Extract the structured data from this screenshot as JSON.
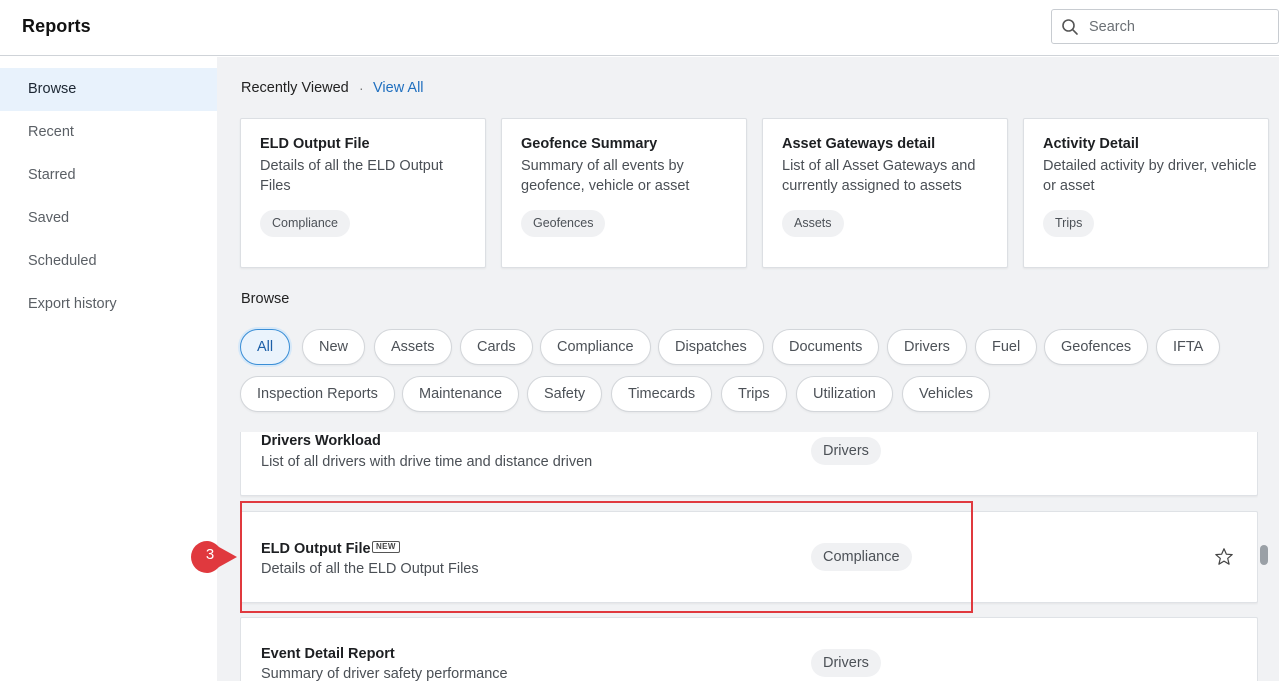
{
  "app": {
    "title": "Reports"
  },
  "search": {
    "placeholder": "Search"
  },
  "sidebar": {
    "items": [
      {
        "label": "Browse",
        "active": true
      },
      {
        "label": "Recent"
      },
      {
        "label": "Starred"
      },
      {
        "label": "Saved"
      },
      {
        "label": "Scheduled"
      },
      {
        "label": "Export history"
      }
    ]
  },
  "recently_viewed": {
    "title": "Recently Viewed",
    "separator": "·",
    "view_all": "View All",
    "cards": [
      {
        "title": "ELD Output File",
        "desc": "Details of all the ELD Output Files",
        "tag": "Compliance"
      },
      {
        "title": "Geofence Summary",
        "desc": "Summary of all events by geofence, vehicle or asset",
        "tag": "Geofences"
      },
      {
        "title": "Asset Gateways detail",
        "desc": "List of all Asset Gateways and currently assigned to assets",
        "tag": "Assets"
      },
      {
        "title": "Activity Detail",
        "desc": "Detailed activity by driver, vehicle or asset",
        "tag": "Trips"
      }
    ]
  },
  "browse": {
    "title": "Browse",
    "filters": [
      "All",
      "New",
      "Assets",
      "Cards",
      "Compliance",
      "Dispatches",
      "Documents",
      "Drivers",
      "Fuel",
      "Geofences",
      "IFTA",
      "Inspection Reports",
      "Maintenance",
      "Safety",
      "Timecards",
      "Trips",
      "Utilization",
      "Vehicles"
    ],
    "active_filter": "All",
    "reports": [
      {
        "title": "Drivers Workload",
        "desc": "List of all drivers with drive time and distance driven",
        "tag": "Drivers"
      },
      {
        "title": "ELD Output File",
        "badge": "NEW",
        "desc": "Details of all the ELD Output Files",
        "tag": "Compliance"
      },
      {
        "title": "Event Detail Report",
        "desc": "Summary of driver safety performance",
        "tag": "Drivers"
      }
    ]
  },
  "annotation": {
    "step": "3",
    "color": "#e0393e"
  },
  "colors": {
    "accent": "#1f6fbf",
    "active_bg": "#e8f2fc",
    "highlight": "#e0393e"
  }
}
